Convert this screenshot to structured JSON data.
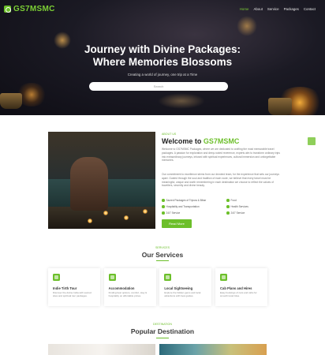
{
  "brand": {
    "name": "GS7MSMC",
    "color": "#6cbf2a"
  },
  "nav": {
    "items": [
      "Home",
      "About",
      "Service",
      "Packages",
      "Contact"
    ],
    "active_index": 0
  },
  "hero": {
    "title_line1": "Journey with Divine Packages:",
    "title_line2": "Where Memories Blossoms",
    "subtitle": "Creating a world of journey, one trip at a Time",
    "search_placeholder": "Search"
  },
  "welcome": {
    "tag": "ABOUT US",
    "title_prefix": "Welcome to ",
    "title_brand": "GS7MSMC",
    "paragraph1": "Welcome to GS7MSMC Packages, where we are dedicated to crafting the most memorable travel packages. A passion for exploration and deep-rooted reverence, experts aim to transform ordinary trips into extraordinary journeys, infused with spiritual experiences, cultural immersion and unforgettable memories.",
    "paragraph2": "Our commitment to excellence stems from our devoted team, for the experience that sets our journeys apart. Guided through the soul and tradition of each route, we believe that every travel must be meaningful, unique and worth remembering in each destination we choose to reflect the values of travellers, sincerity and divine beauty.",
    "checks": [
      "Sacred Packages of Tripura & Bihar",
      "Hospitality and Transportation",
      "24/7 Service",
      "Food",
      "Health Services",
      "24/7 Service"
    ],
    "button_label": "Read More"
  },
  "services": {
    "tag": "SERVICES",
    "title": "Our Services",
    "items": [
      {
        "title": "Indie Tirth Tour",
        "desc": "Discover the divine India with sacred sites and spiritual tour packages."
      },
      {
        "title": "Accommodation",
        "desc": "Finding best options, comfort, stay & hospitality on affordable prices."
      },
      {
        "title": "Local Sightseeing",
        "desc": "Explore the hidden gems and local attractions with best guides."
      },
      {
        "title": "Cab Plans and Hires",
        "desc": "Easy bookings of cars and cabs for smooth local rides."
      }
    ],
    "icons": [
      "tour-icon",
      "hotel-icon",
      "guide-icon",
      "car-icon"
    ]
  },
  "destinations": {
    "tag": "DESTINATION",
    "title": "Popular Destination"
  }
}
